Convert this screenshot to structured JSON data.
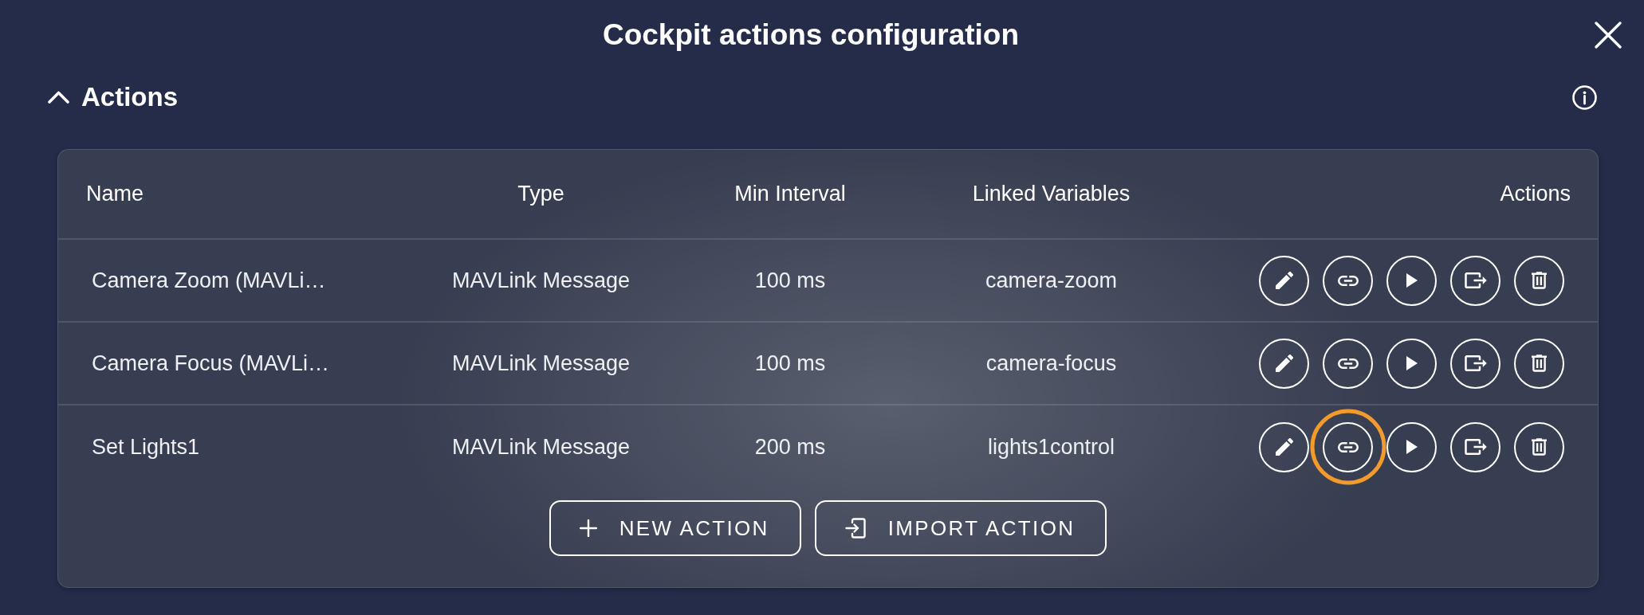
{
  "dialog": {
    "title": "Cockpit actions configuration"
  },
  "section": {
    "title": "Actions",
    "expanded": true
  },
  "table": {
    "columns": [
      "Name",
      "Type",
      "Min Interval",
      "Linked Variables",
      "Actions"
    ],
    "rows": [
      {
        "name": "Camera Zoom (MAVLi…",
        "type": "MAVLink Message",
        "min_interval": "100 ms",
        "linked_variables": "camera-zoom",
        "actions": [
          {
            "kind": "edit",
            "highlighted": false
          },
          {
            "kind": "link",
            "highlighted": false
          },
          {
            "kind": "run",
            "highlighted": false
          },
          {
            "kind": "export",
            "highlighted": false
          },
          {
            "kind": "delete",
            "highlighted": false
          }
        ]
      },
      {
        "name": "Camera Focus (MAVLi…",
        "type": "MAVLink Message",
        "min_interval": "100 ms",
        "linked_variables": "camera-focus",
        "actions": [
          {
            "kind": "edit",
            "highlighted": false
          },
          {
            "kind": "link",
            "highlighted": false
          },
          {
            "kind": "run",
            "highlighted": false
          },
          {
            "kind": "export",
            "highlighted": false
          },
          {
            "kind": "delete",
            "highlighted": false
          }
        ]
      },
      {
        "name": "Set Lights1",
        "type": "MAVLink Message",
        "min_interval": "200 ms",
        "linked_variables": "lights1control",
        "actions": [
          {
            "kind": "edit",
            "highlighted": false
          },
          {
            "kind": "link",
            "highlighted": true
          },
          {
            "kind": "run",
            "highlighted": false
          },
          {
            "kind": "export",
            "highlighted": false
          },
          {
            "kind": "delete",
            "highlighted": false
          }
        ]
      }
    ]
  },
  "buttons": [
    {
      "kind": "new",
      "label": "NEW ACTION"
    },
    {
      "kind": "import",
      "label": "IMPORT ACTION"
    }
  ]
}
